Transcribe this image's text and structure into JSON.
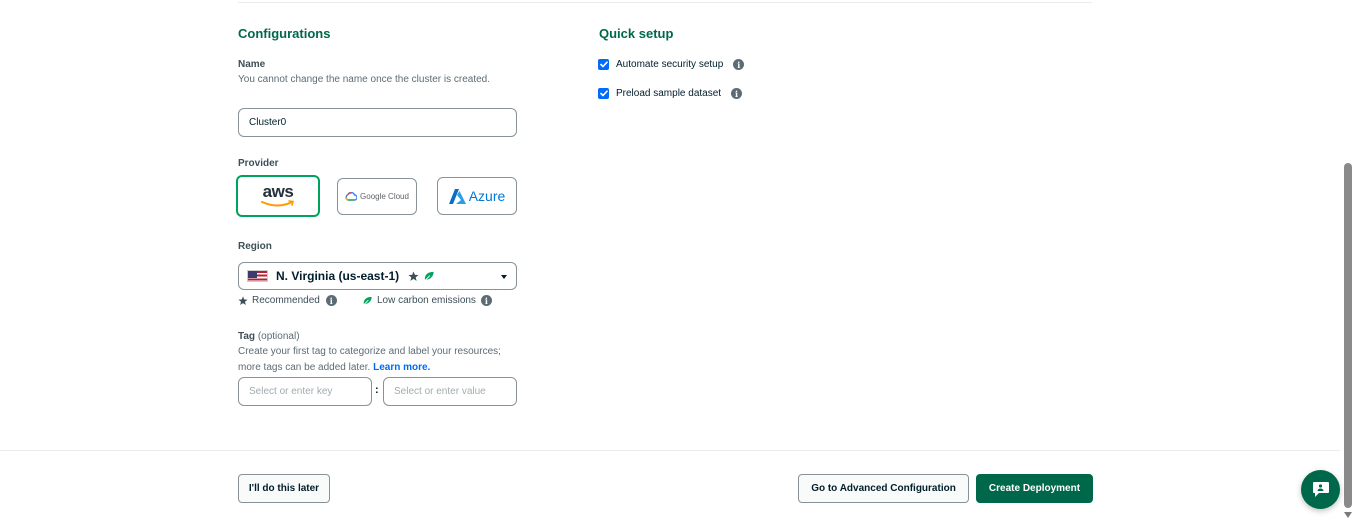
{
  "configurations": {
    "title": "Configurations",
    "name": {
      "label": "Name",
      "description": "You cannot change the name once the cluster is created.",
      "value": "Cluster0"
    },
    "provider": {
      "label": "Provider",
      "options": [
        {
          "label": "aws",
          "selected": true
        },
        {
          "label": "Google Cloud",
          "selected": false
        },
        {
          "label": "Azure",
          "selected": false
        }
      ]
    },
    "region": {
      "label": "Region",
      "selected": "N. Virginia (us-east-1)",
      "recommended_label": "Recommended",
      "low_carbon_label": "Low carbon emissions"
    },
    "tag": {
      "label": "Tag",
      "optional_label": "(optional)",
      "description": "Create your first tag to categorize and label your resources; more tags can be added later.",
      "learn_more": "Learn more.",
      "key_placeholder": "Select or enter key",
      "separator": ":",
      "value_placeholder": "Select or enter value"
    }
  },
  "quick_setup": {
    "title": "Quick setup",
    "options": [
      {
        "label": "Automate security setup",
        "checked": true
      },
      {
        "label": "Preload sample dataset",
        "checked": true
      }
    ]
  },
  "footer": {
    "later_label": "I'll do this later",
    "advanced_label": "Go to Advanced Configuration",
    "create_label": "Create Deployment"
  },
  "colors": {
    "brand_green": "#00684a",
    "selected_border": "#00a35c",
    "checkbox_blue": "#016bf8",
    "link_blue": "#016bf8"
  },
  "icons": [
    "star-icon",
    "leaf-icon",
    "info-icon",
    "chevron-down-icon",
    "check-icon",
    "chat-icon",
    "us-flag-icon",
    "aws-logo",
    "google-cloud-logo",
    "azure-logo"
  ]
}
